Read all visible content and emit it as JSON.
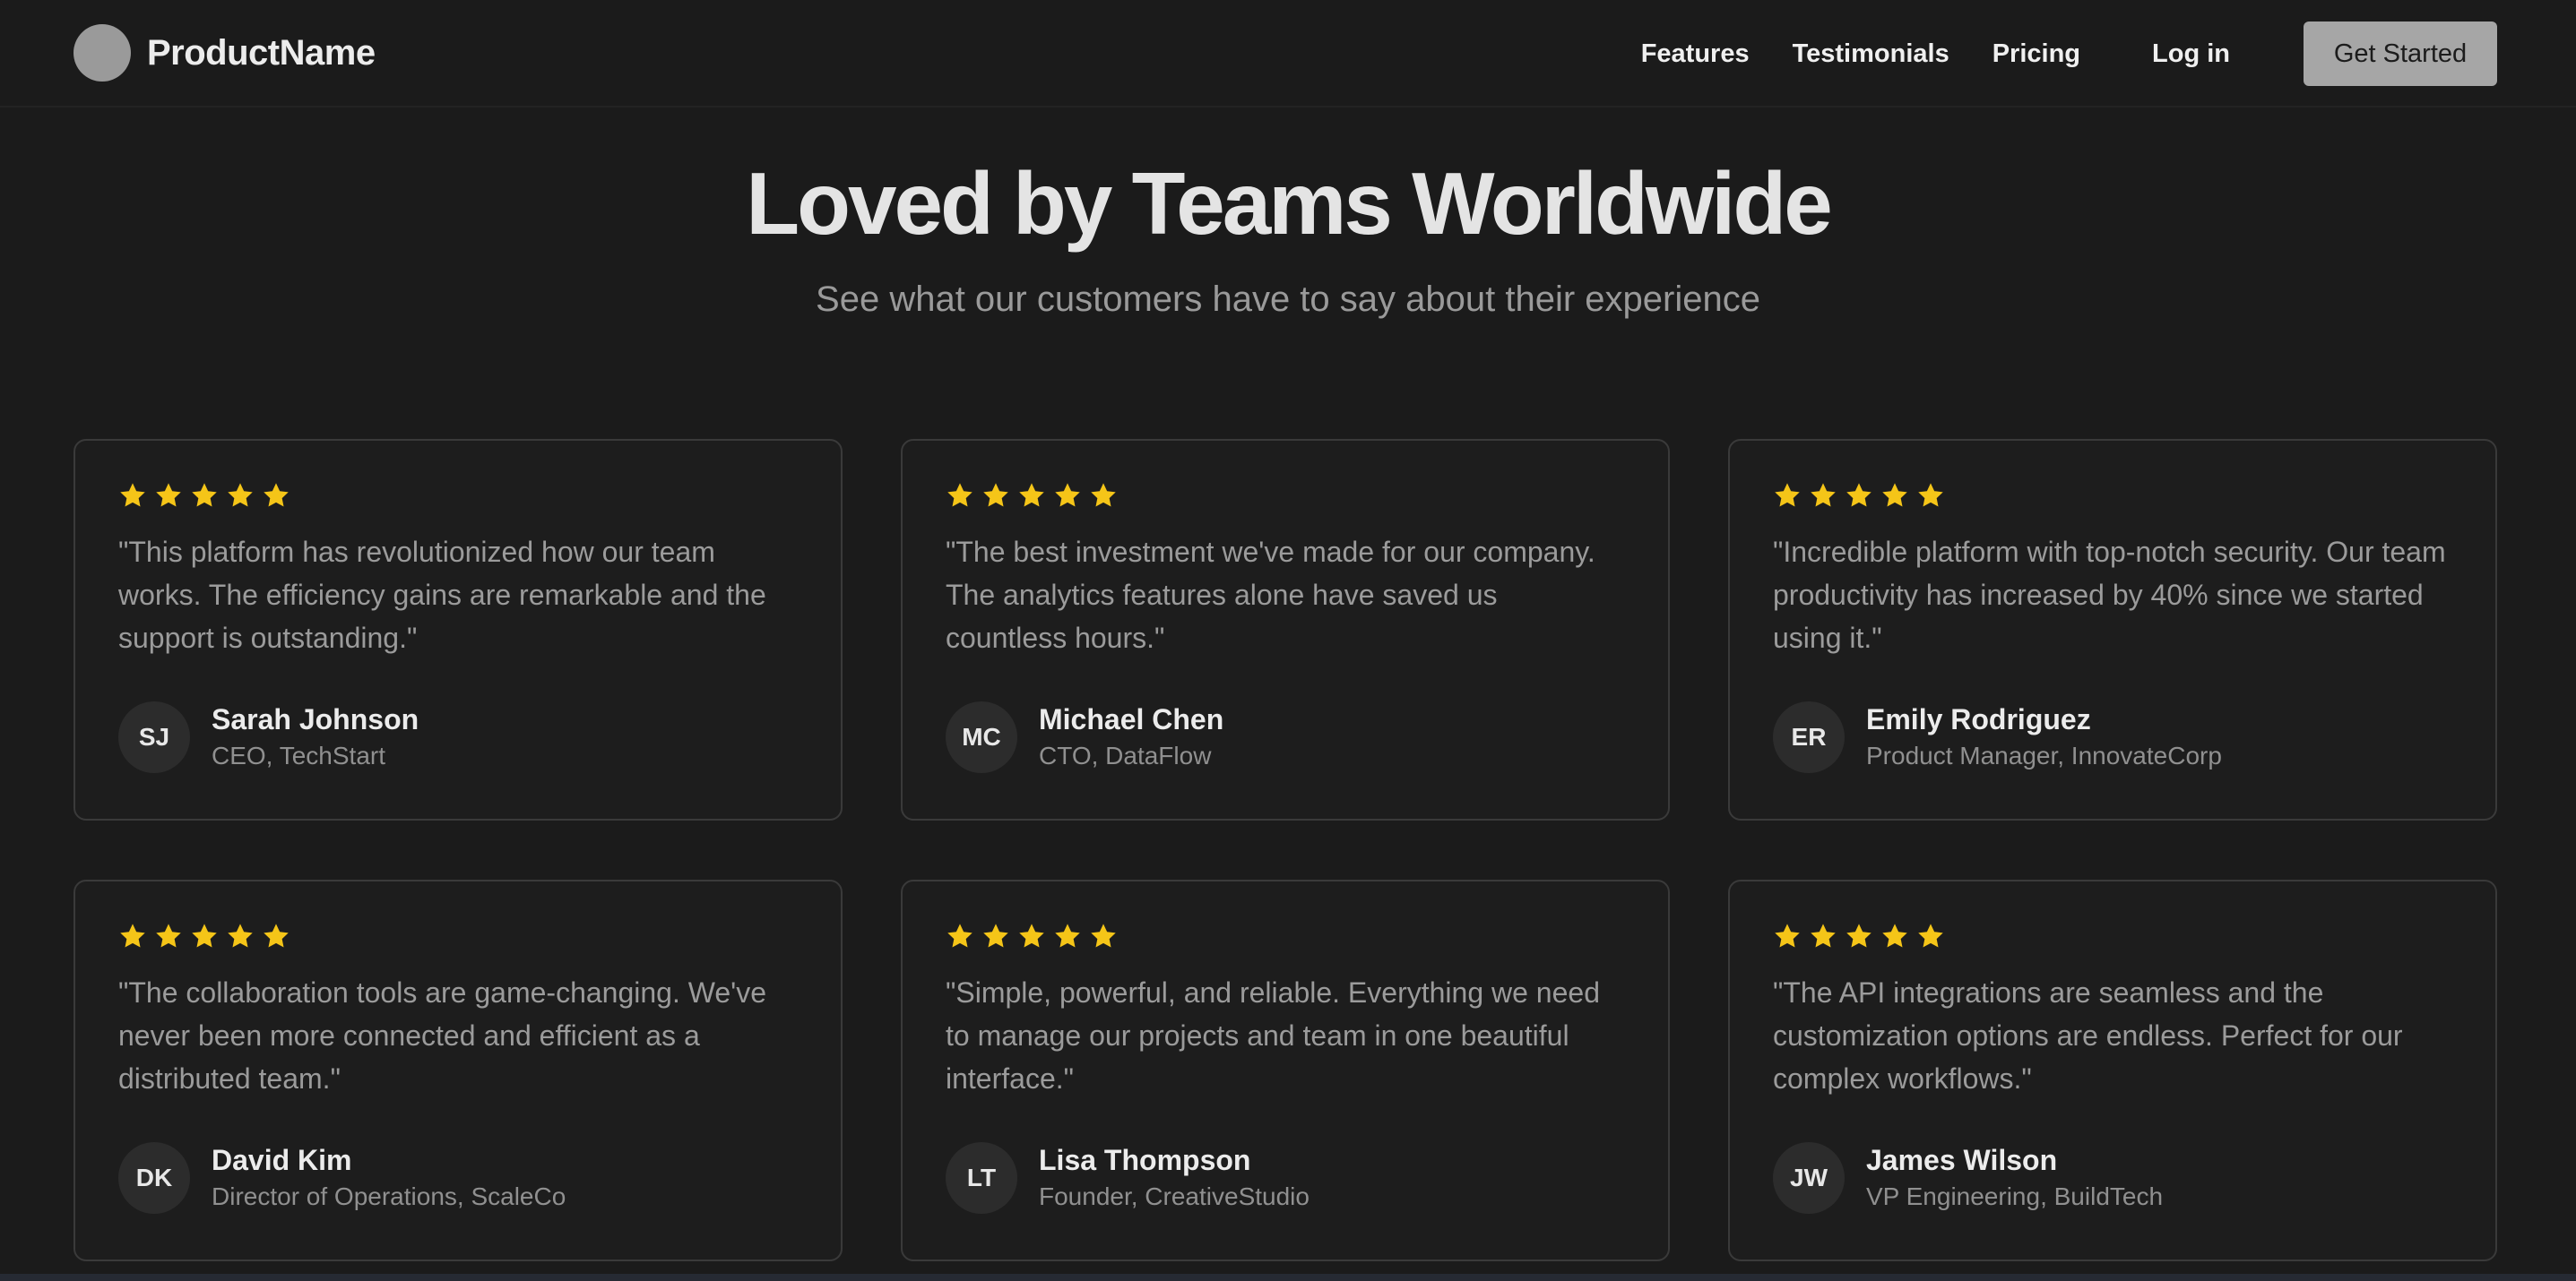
{
  "nav": {
    "brand": "ProductName",
    "links": [
      "Features",
      "Testimonials",
      "Pricing"
    ],
    "login": "Log in",
    "cta": "Get Started"
  },
  "hero": {
    "title": "Loved by Teams Worldwide",
    "subtitle": "See what our customers have to say about their experience"
  },
  "colors": {
    "background": "#1b1b1b",
    "card_border": "#3a3a3a",
    "star": "#f5c518",
    "cta_bg": "#a6a6a6"
  },
  "testimonials": [
    {
      "rating": 5,
      "quote": "\"This platform has revolutionized how our team works. The efficiency gains are remarkable and the support is outstanding.\"",
      "initials": "SJ",
      "name": "Sarah Johnson",
      "role": "CEO, TechStart"
    },
    {
      "rating": 5,
      "quote": "\"The best investment we've made for our company. The analytics features alone have saved us countless hours.\"",
      "initials": "MC",
      "name": "Michael Chen",
      "role": "CTO, DataFlow"
    },
    {
      "rating": 5,
      "quote": "\"Incredible platform with top-notch security. Our team productivity has increased by 40% since we started using it.\"",
      "initials": "ER",
      "name": "Emily Rodriguez",
      "role": "Product Manager, InnovateCorp"
    },
    {
      "rating": 5,
      "quote": "\"The collaboration tools are game-changing. We've never been more connected and efficient as a distributed team.\"",
      "initials": "DK",
      "name": "David Kim",
      "role": "Director of Operations, ScaleCo"
    },
    {
      "rating": 5,
      "quote": "\"Simple, powerful, and reliable. Everything we need to manage our projects and team in one beautiful interface.\"",
      "initials": "LT",
      "name": "Lisa Thompson",
      "role": "Founder, CreativeStudio"
    },
    {
      "rating": 5,
      "quote": "\"The API integrations are seamless and the customization options are endless. Perfect for our complex workflows.\"",
      "initials": "JW",
      "name": "James Wilson",
      "role": "VP Engineering, BuildTech"
    }
  ]
}
